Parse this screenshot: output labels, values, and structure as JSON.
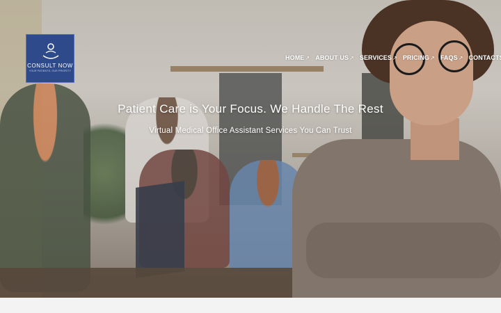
{
  "logo": {
    "name": "CONSULT NOW",
    "tagline": "YOUR PATIENTS, OUR PRIORITY"
  },
  "nav": {
    "items": [
      {
        "label": "HOME",
        "arrow": "↗"
      },
      {
        "label": "ABOUT US",
        "arrow": "↗"
      },
      {
        "label": "SERVICES",
        "arrow": "↗"
      },
      {
        "label": "PRICING",
        "arrow": "↗"
      },
      {
        "label": "FAQS",
        "arrow": "↗"
      },
      {
        "label": "CONTACTS",
        "arrow": "↗"
      }
    ]
  },
  "hero": {
    "headline": "Patient Care is Your Focus. We Handle The Rest",
    "subheadline": "Virtual Medical Office Assistant Services You Can Trust"
  },
  "colors": {
    "logo_bg": "#2e4a8a",
    "text": "#ffffff"
  }
}
